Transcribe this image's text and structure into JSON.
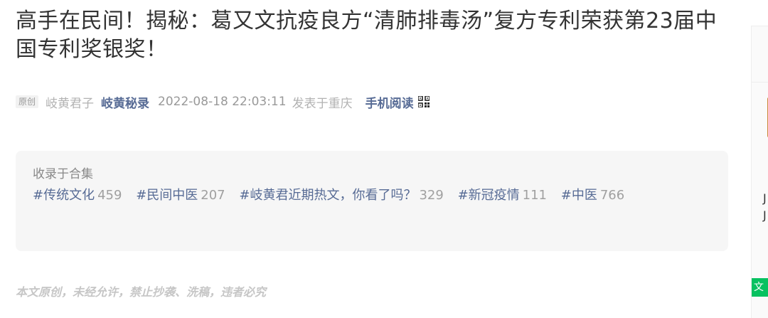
{
  "article": {
    "title": "高手在民间！揭秘：葛又文抗疫良方“清肺排毒汤”复方专利荣获第23届中国专利奖银奖！",
    "badge": "原创",
    "author_name": "岐黄君子",
    "account_name": "岐黄秘录",
    "publish_time": "2022-08-18 22:03:11",
    "location": "发表于重庆",
    "mobile_read": "手机阅读",
    "qr_icon": "qr-code-icon"
  },
  "collection": {
    "label": "收录于合集",
    "tags": [
      {
        "name": "#传统文化",
        "count": "459"
      },
      {
        "name": "#民间中医",
        "count": "207"
      },
      {
        "name": "#岐黄君近期热文，你看了吗？",
        "count": "329"
      },
      {
        "name": "#新冠疫情",
        "count": "111"
      },
      {
        "name": "#中医",
        "count": "766"
      }
    ]
  },
  "notice": "本文原创，未经允许，禁止抄袭、洗稿，违者必究",
  "sidebar": {
    "glyph1": "J",
    "glyph2": "J",
    "green_tag": "文"
  },
  "colors": {
    "link": "#576b95",
    "tag_bg": "#f6f6f6",
    "green": "#07c160"
  }
}
